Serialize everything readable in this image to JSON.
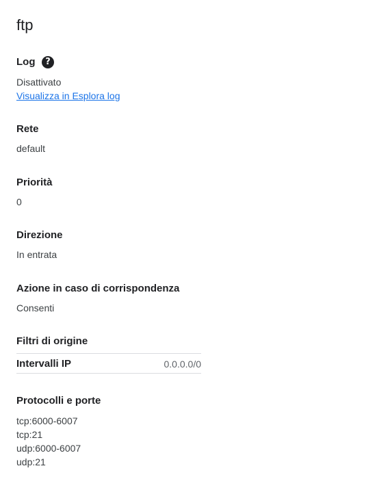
{
  "page": {
    "title": "ftp"
  },
  "log": {
    "label": "Log",
    "help_icon": "?",
    "status": "Disattivato",
    "link": "Visualizza in Esplora log"
  },
  "network": {
    "label": "Rete",
    "value": "default"
  },
  "priority": {
    "label": "Priorità",
    "value": "0"
  },
  "direction": {
    "label": "Direzione",
    "value": "In entrata"
  },
  "action": {
    "label": "Azione in caso di corrispondenza",
    "value": "Consenti"
  },
  "source_filters": {
    "label": "Filtri di origine",
    "rows": [
      {
        "key": "Intervalli IP",
        "value": "0.0.0.0/0"
      }
    ]
  },
  "protocols": {
    "label": "Protocolli e porte",
    "items": [
      "tcp:6000-6007",
      "tcp:21",
      "udp:6000-6007",
      "udp:21"
    ]
  },
  "colors": {
    "link": "#1a73e8",
    "text": "#202124",
    "divider": "#dadce0"
  }
}
